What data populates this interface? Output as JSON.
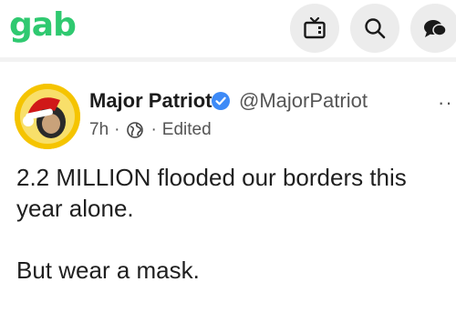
{
  "header": {
    "logo_text": "gab",
    "logo_color": "#2fc970",
    "icons": [
      "tv-icon",
      "search-icon",
      "chat-icon"
    ]
  },
  "post": {
    "author_name": "Major Patriot",
    "handle": "@MajorPatriot",
    "time": "7h",
    "visibility_icon": "globe-icon",
    "edited_label": "Edited",
    "more_label": "··",
    "body_line1": "2.2 MILLION flooded our borders this year alone.",
    "body_line2": "But wear a mask.",
    "verified_color": "#3d8af7"
  }
}
